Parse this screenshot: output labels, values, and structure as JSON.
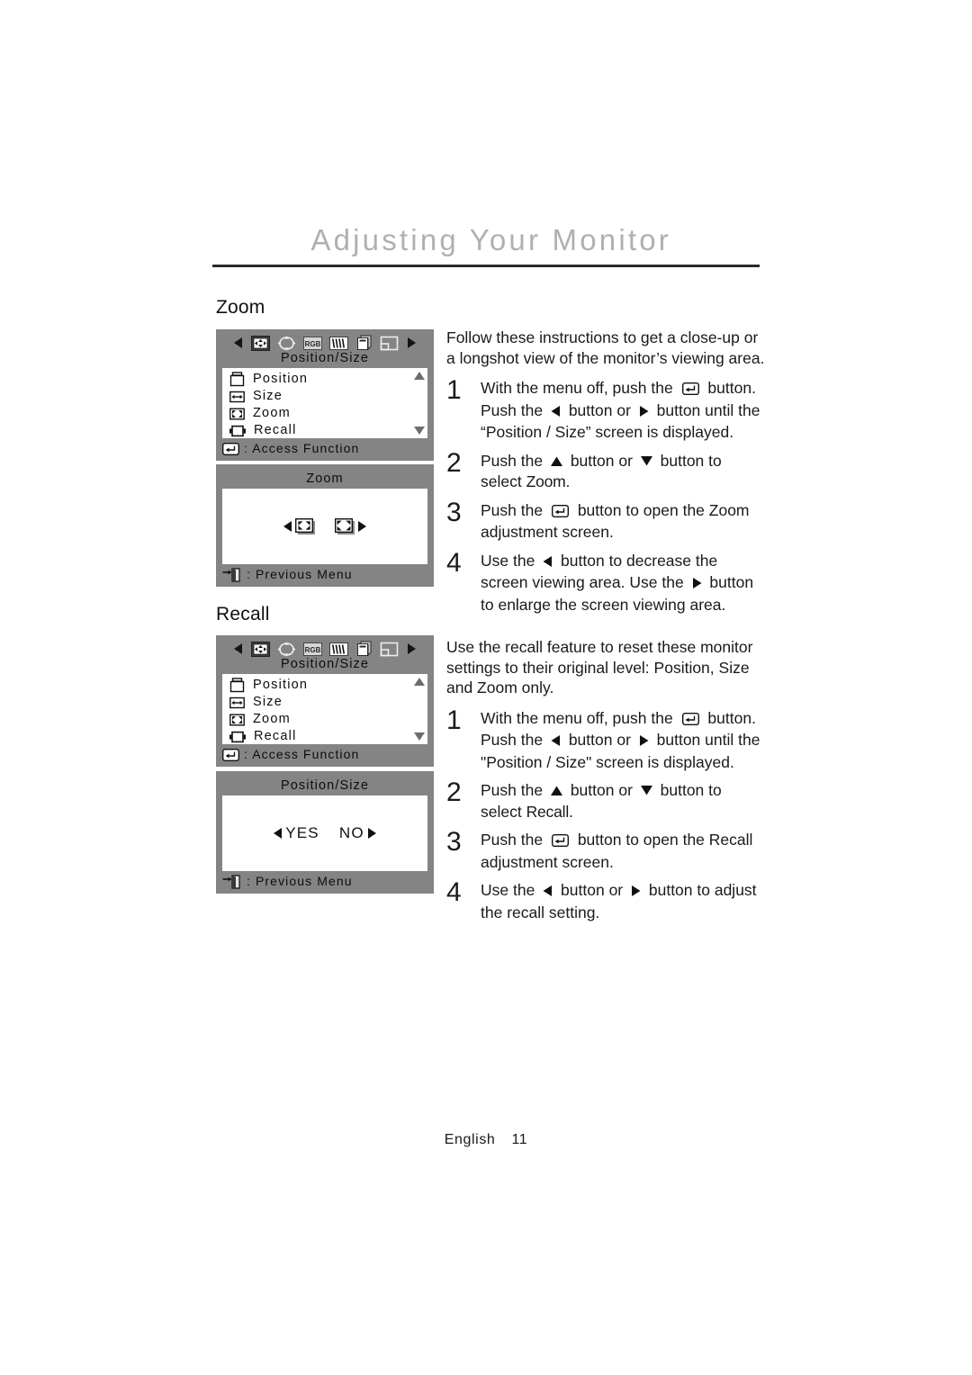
{
  "header": {
    "title": "Adjusting Your Monitor"
  },
  "sections": [
    {
      "heading": "Zoom",
      "intro": "Follow these instructions to get a close-up or a longshot view of the monitor’s viewing area.",
      "osd_menu": {
        "title": "Position/Size",
        "icons": [
          "prev-arrow-icon",
          "position-size-icon",
          "geometry-icon",
          "rgb-icon",
          "moire-icon",
          "osd-icon",
          "information-icon",
          "next-arrow-icon"
        ],
        "items": [
          {
            "icon": "position-menu-icon",
            "label": "Position"
          },
          {
            "icon": "size-menu-icon",
            "label": "Size"
          },
          {
            "icon": "zoom-menu-icon",
            "label": "Zoom"
          },
          {
            "icon": "recall-menu-icon",
            "label": "Recall"
          }
        ],
        "footer_icon": "enter-key-icon",
        "footer_label": ": Access Function"
      },
      "osd_adjust": {
        "title": "Zoom",
        "widgets": [
          "zoom-out-icon",
          "zoom-in-icon"
        ],
        "footer_icon": "exit-door-icon",
        "footer_label": ": Previous Menu"
      },
      "steps": [
        {
          "num": "1",
          "parts": [
            {
              "t": "text",
              "v": "With the menu off, push the "
            },
            {
              "t": "icon",
              "v": "enter-key-icon"
            },
            {
              "t": "text",
              "v": " button. Push the "
            },
            {
              "t": "icon",
              "v": "left-arrow-icon"
            },
            {
              "t": "text",
              "v": " button or "
            },
            {
              "t": "icon",
              "v": "right-arrow-icon"
            },
            {
              "t": "text",
              "v": " button until the “Position / Size” screen is displayed."
            }
          ]
        },
        {
          "num": "2",
          "parts": [
            {
              "t": "text",
              "v": "Push the "
            },
            {
              "t": "icon",
              "v": "up-arrow-icon"
            },
            {
              "t": "text",
              "v": " button or "
            },
            {
              "t": "icon",
              "v": "down-arrow-icon"
            },
            {
              "t": "text",
              "v": " button to select "
            },
            {
              "t": "emph",
              "v": "Zoom"
            },
            {
              "t": "text",
              "v": "."
            }
          ]
        },
        {
          "num": "3",
          "parts": [
            {
              "t": "text",
              "v": "Push the "
            },
            {
              "t": "icon",
              "v": "enter-key-icon"
            },
            {
              "t": "text",
              "v": " button to open the Zoom adjustment screen."
            }
          ]
        },
        {
          "num": "4",
          "parts": [
            {
              "t": "text",
              "v": "Use the "
            },
            {
              "t": "icon",
              "v": "left-arrow-icon"
            },
            {
              "t": "text",
              "v": " button to decrease the screen viewing area. Use the "
            },
            {
              "t": "icon",
              "v": "right-arrow-icon"
            },
            {
              "t": "text",
              "v": " button to enlarge the screen viewing area."
            }
          ]
        }
      ]
    },
    {
      "heading": "Recall",
      "intro": "Use the recall feature to reset these monitor settings to their original level: Position, Size and Zoom only.",
      "osd_menu": {
        "title": "Position/Size",
        "icons": [
          "prev-arrow-icon",
          "position-size-icon",
          "geometry-icon",
          "rgb-icon",
          "moire-icon",
          "osd-icon",
          "information-icon",
          "next-arrow-icon"
        ],
        "items": [
          {
            "icon": "position-menu-icon",
            "label": "Position"
          },
          {
            "icon": "size-menu-icon",
            "label": "Size"
          },
          {
            "icon": "zoom-menu-icon",
            "label": "Zoom"
          },
          {
            "icon": "recall-menu-icon",
            "label": "Recall"
          }
        ],
        "footer_icon": "enter-key-icon",
        "footer_label": ": Access Function"
      },
      "osd_adjust": {
        "title": "Position/Size",
        "yes_label": "YES",
        "no_label": "NO",
        "footer_icon": "exit-door-icon",
        "footer_label": ": Previous Menu"
      },
      "steps": [
        {
          "num": "1",
          "parts": [
            {
              "t": "text",
              "v": "With the menu off, push the "
            },
            {
              "t": "icon",
              "v": "enter-key-icon"
            },
            {
              "t": "text",
              "v": " button. Push the "
            },
            {
              "t": "icon",
              "v": "left-arrow-icon"
            },
            {
              "t": "text",
              "v": " button or "
            },
            {
              "t": "icon",
              "v": "right-arrow-icon"
            },
            {
              "t": "text",
              "v": " button until the \"Position / Size\" screen is displayed."
            }
          ]
        },
        {
          "num": "2",
          "parts": [
            {
              "t": "text",
              "v": "Push the "
            },
            {
              "t": "icon",
              "v": "up-arrow-icon"
            },
            {
              "t": "text",
              "v": " button or "
            },
            {
              "t": "icon",
              "v": "down-arrow-icon"
            },
            {
              "t": "text",
              "v": " button to select "
            },
            {
              "t": "emph",
              "v": "Recall"
            },
            {
              "t": "text",
              "v": "."
            }
          ]
        },
        {
          "num": "3",
          "parts": [
            {
              "t": "text",
              "v": "Push the "
            },
            {
              "t": "icon",
              "v": "enter-key-icon"
            },
            {
              "t": "text",
              "v": " button to open the Recall adjustment screen."
            }
          ]
        },
        {
          "num": "4",
          "parts": [
            {
              "t": "text",
              "v": "Use the "
            },
            {
              "t": "icon",
              "v": "left-arrow-icon"
            },
            {
              "t": "text",
              "v": " button or "
            },
            {
              "t": "icon",
              "v": "right-arrow-icon"
            },
            {
              "t": "text",
              "v": " button to adjust the recall setting."
            }
          ]
        }
      ]
    }
  ],
  "footer": {
    "language": "English",
    "page_number": "11"
  },
  "colors": {
    "osd_background": "#848484",
    "osd_screen": "#ffffff",
    "header_title": "#b0b0b0",
    "rule": "#2b2b2b",
    "body_text": "#1a1a1a"
  }
}
